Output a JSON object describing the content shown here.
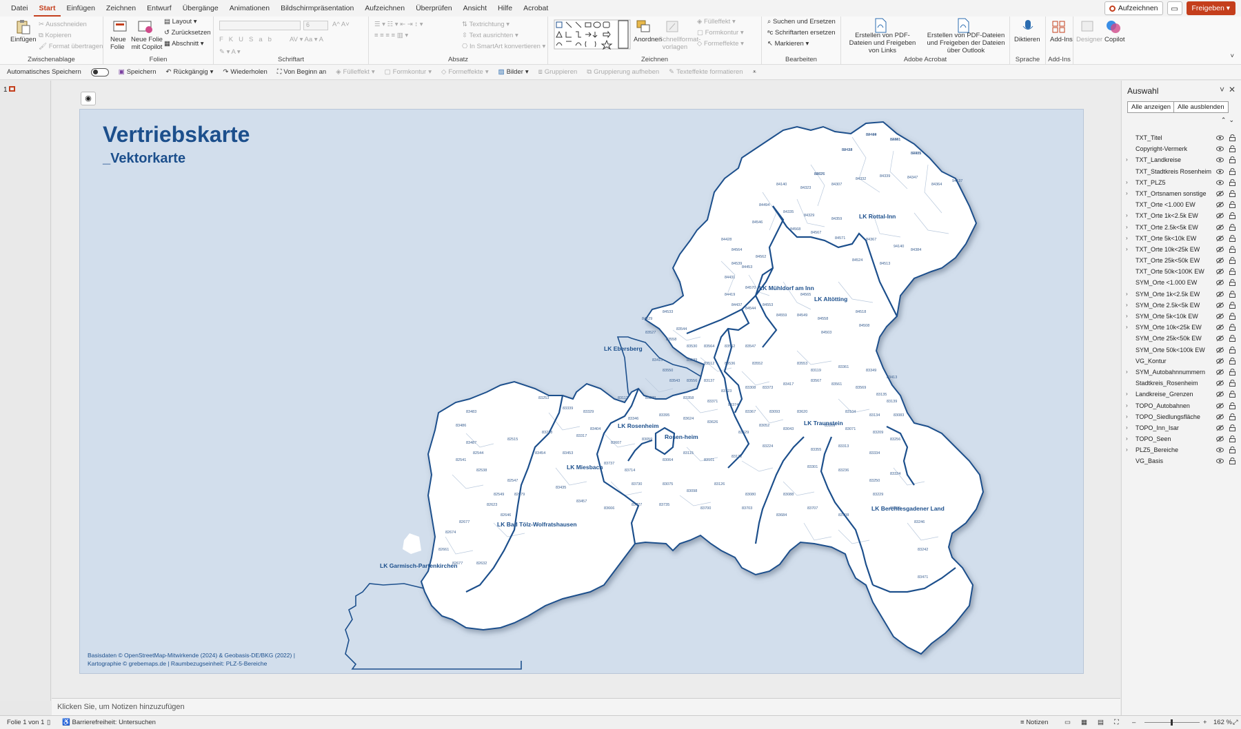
{
  "menu": {
    "tabs": [
      "Datei",
      "Start",
      "Einfügen",
      "Zeichnen",
      "Entwurf",
      "Übergänge",
      "Animationen",
      "Bildschirmpräsentation",
      "Aufzeichnen",
      "Überprüfen",
      "Ansicht",
      "Hilfe",
      "Acrobat"
    ],
    "active_tab": "Start",
    "record_label": "Aufzeichnen",
    "share_label": "Freigeben"
  },
  "ribbon": {
    "clipboard": {
      "paste": "Einfügen",
      "cut": "Ausschneiden",
      "copy": "Kopieren",
      "format_painter": "Format übertragen",
      "label": "Zwischenablage"
    },
    "slides": {
      "new_slide": "Neue Folie",
      "new_copilot": "Neue Folie mit Copilot",
      "layout": "Layout",
      "reset": "Zurücksetzen",
      "section": "Abschnitt",
      "label": "Folien"
    },
    "font": {
      "label": "Schriftart",
      "size": "6"
    },
    "paragraph": {
      "text_direction": "Textrichtung",
      "align_text": "Text ausrichten",
      "smartart": "In SmartArt konvertieren",
      "label": "Absatz"
    },
    "drawing": {
      "arrange": "Anordnen",
      "quick_styles": "Schnellformat-vorlagen",
      "fill": "Fülleffekt",
      "outline": "Formkontur",
      "effects": "Formeffekte",
      "label": "Zeichnen"
    },
    "editing": {
      "find_replace": "Suchen und Ersetzen",
      "replace_fonts": "Schriftarten ersetzen",
      "select": "Markieren",
      "label": "Bearbeiten"
    },
    "acrobat": {
      "create_share_links": "Erstellen von PDF-Dateien und Freigeben von Links",
      "create_share_outlook": "Erstellen von PDF-Dateien und Freigeben der Dateien über Outlook",
      "label": "Adobe Acrobat"
    },
    "voice": {
      "dictate": "Diktieren",
      "label": "Sprache"
    },
    "addins": {
      "addins": "Add-Ins",
      "label": "Add-Ins"
    },
    "designer": "Designer",
    "copilot": "Copilot"
  },
  "qat": {
    "autosave": "Automatisches Speichern",
    "save": "Speichern",
    "undo": "Rückgängig",
    "redo": "Wiederholen",
    "from_start": "Von Beginn an",
    "fill": "Fülleffekt",
    "outline": "Formkontur",
    "effects": "Formeffekte",
    "pictures": "Bilder",
    "group": "Gruppieren",
    "ungroup": "Gruppierung aufheben",
    "text_effects": "Texteffekte formatieren"
  },
  "thumbs": {
    "slide_number": "1"
  },
  "slide": {
    "title": "Vertriebskarte",
    "subtitle": "_Vektorkarte",
    "credits_line1": "Basisdaten © OpenStreetMap-Mitwirkende (2024) & Geobasis-DE/BKG (2022) |",
    "credits_line2": "Kartographie © grebemaps.de | Raumbezugseinheit: PLZ-5-Bereiche",
    "districts": [
      {
        "name": "LK Rottal-Inn"
      },
      {
        "name": "LK Mühldorf am Inn"
      },
      {
        "name": "LK Altötting"
      },
      {
        "name": "LK Ebersberg"
      },
      {
        "name": "LK Rosenheim"
      },
      {
        "name": "Rosen-heim"
      },
      {
        "name": "LK Traunstein"
      },
      {
        "name": "LK Miesbach"
      },
      {
        "name": "LK Bad Tölz-Wolfratshausen"
      },
      {
        "name": "LK Berchtesgadener Land"
      },
      {
        "name": "LK Garmisch-Partenkirchen"
      }
    ],
    "postcodes": [
      "84419",
      "84381",
      "84385",
      "84424",
      "84326",
      "84140",
      "84323",
      "84307",
      "84332",
      "84339",
      "84347",
      "84364",
      "94137",
      "84494",
      "84546",
      "84335",
      "84329",
      "84359",
      "84367",
      "94140",
      "84568",
      "84567",
      "84571",
      "84524",
      "84513",
      "84384",
      "84428",
      "84564",
      "84539",
      "84431",
      "84453",
      "84562",
      "84570",
      "84419",
      "84437",
      "84544",
      "84553",
      "84559",
      "84565",
      "84549",
      "84503",
      "84558",
      "84518",
      "84508",
      "84533",
      "84529",
      "83527",
      "83558",
      "83544",
      "83530",
      "83564",
      "83562",
      "83547",
      "83539",
      "83512",
      "83536",
      "83552",
      "83553",
      "83119",
      "83361",
      "83349",
      "83413",
      "83410",
      "83550",
      "83543",
      "83556",
      "83137",
      "83123",
      "83308",
      "83373",
      "83417",
      "83567",
      "83561",
      "83569",
      "83135",
      "83139",
      "83112",
      "83370",
      "83358",
      "83371",
      "83374",
      "83367",
      "83093",
      "83620",
      "83104",
      "83134",
      "83083",
      "83253",
      "83339",
      "83329",
      "83346",
      "83395",
      "83624",
      "83626",
      "83629",
      "83052",
      "83043",
      "83109",
      "83071",
      "83209",
      "83256",
      "83278",
      "83317",
      "83404",
      "83607",
      "83059",
      "83064",
      "83115",
      "83101",
      "83132",
      "83224",
      "83355",
      "83313",
      "83334",
      "83454",
      "83453",
      "83737",
      "83714",
      "83730",
      "83075",
      "83098",
      "83126",
      "83080",
      "83088",
      "83301",
      "83236",
      "83250",
      "83324",
      "83435",
      "83457",
      "83666",
      "83727",
      "83735",
      "83700",
      "83703",
      "83684",
      "83707",
      "83708",
      "83229",
      "83259",
      "83246",
      "83242",
      "83471",
      "83483",
      "83486",
      "83487",
      "82544",
      "82541",
      "82538",
      "82515",
      "82547",
      "82549",
      "82623",
      "82679",
      "82646",
      "82677",
      "82674",
      "82661",
      "82677",
      "82632",
      "82444",
      "82441",
      "82431",
      "82432",
      "82676"
    ]
  },
  "panel": {
    "title": "Auswahl",
    "show_all": "Alle anzeigen",
    "hide_all": "Alle ausblenden",
    "layers": [
      {
        "name": "TXT_Titel",
        "expandable": false,
        "visible": true
      },
      {
        "name": "Copyright-Vermerk",
        "expandable": false,
        "visible": true
      },
      {
        "name": "TXT_Landkreise",
        "expandable": true,
        "visible": true
      },
      {
        "name": "TXT_Stadtkreis Rosenheim",
        "expandable": false,
        "visible": true
      },
      {
        "name": "TXT_PLZ5",
        "expandable": true,
        "visible": true
      },
      {
        "name": "TXT_Ortsnamen sonstige",
        "expandable": true,
        "visible": false
      },
      {
        "name": "TXT_Orte <1.000 EW",
        "expandable": false,
        "visible": false
      },
      {
        "name": "TXT_Orte 1k<2.5k EW",
        "expandable": true,
        "visible": false
      },
      {
        "name": "TXT_Orte 2.5k<5k EW",
        "expandable": true,
        "visible": false
      },
      {
        "name": "TXT_Orte 5k<10k EW",
        "expandable": true,
        "visible": false
      },
      {
        "name": "TXT_Orte 10k<25k EW",
        "expandable": true,
        "visible": false
      },
      {
        "name": "TXT_Orte 25k<50k EW",
        "expandable": false,
        "visible": false
      },
      {
        "name": "TXT_Orte 50k<100K EW",
        "expandable": false,
        "visible": false
      },
      {
        "name": "SYM_Orte <1.000 EW",
        "expandable": false,
        "visible": false
      },
      {
        "name": "SYM_Orte 1k<2.5k EW",
        "expandable": true,
        "visible": false
      },
      {
        "name": "SYM_Orte 2.5k<5k EW",
        "expandable": true,
        "visible": false
      },
      {
        "name": "SYM_Orte 5k<10k EW",
        "expandable": true,
        "visible": false
      },
      {
        "name": "SYM_Orte 10k<25k EW",
        "expandable": true,
        "visible": false
      },
      {
        "name": "SYM_Orte 25k<50k EW",
        "expandable": false,
        "visible": false
      },
      {
        "name": "SYM_Orte 50k<100k EW",
        "expandable": false,
        "visible": false
      },
      {
        "name": "VG_Kontur",
        "expandable": false,
        "visible": false
      },
      {
        "name": "SYM_Autobahnnummern",
        "expandable": true,
        "visible": false
      },
      {
        "name": "Stadtkreis_Rosenheim",
        "expandable": false,
        "visible": false
      },
      {
        "name": "Landkreise_Grenzen",
        "expandable": true,
        "visible": false
      },
      {
        "name": "TOPO_Autobahnen",
        "expandable": true,
        "visible": false
      },
      {
        "name": "TOPO_Siedlungsfläche",
        "expandable": true,
        "visible": false
      },
      {
        "name": "TOPO_Inn_Isar",
        "expandable": true,
        "visible": false
      },
      {
        "name": "TOPO_Seen",
        "expandable": true,
        "visible": false
      },
      {
        "name": "PLZ5_Bereiche",
        "expandable": true,
        "visible": true
      },
      {
        "name": "VG_Basis",
        "expandable": false,
        "visible": true
      }
    ]
  },
  "notes": {
    "placeholder": "Klicken Sie, um Notizen hinzuzufügen"
  },
  "status": {
    "slide_info": "Folie 1 von 1",
    "accessibility": "Barrierefreiheit: Untersuchen",
    "notes_label": "Notizen",
    "zoom": "162 %"
  },
  "colors": {
    "accent": "#c43e1c",
    "map_blue": "#1c4f8c",
    "slide_bg": "#d2deec"
  }
}
